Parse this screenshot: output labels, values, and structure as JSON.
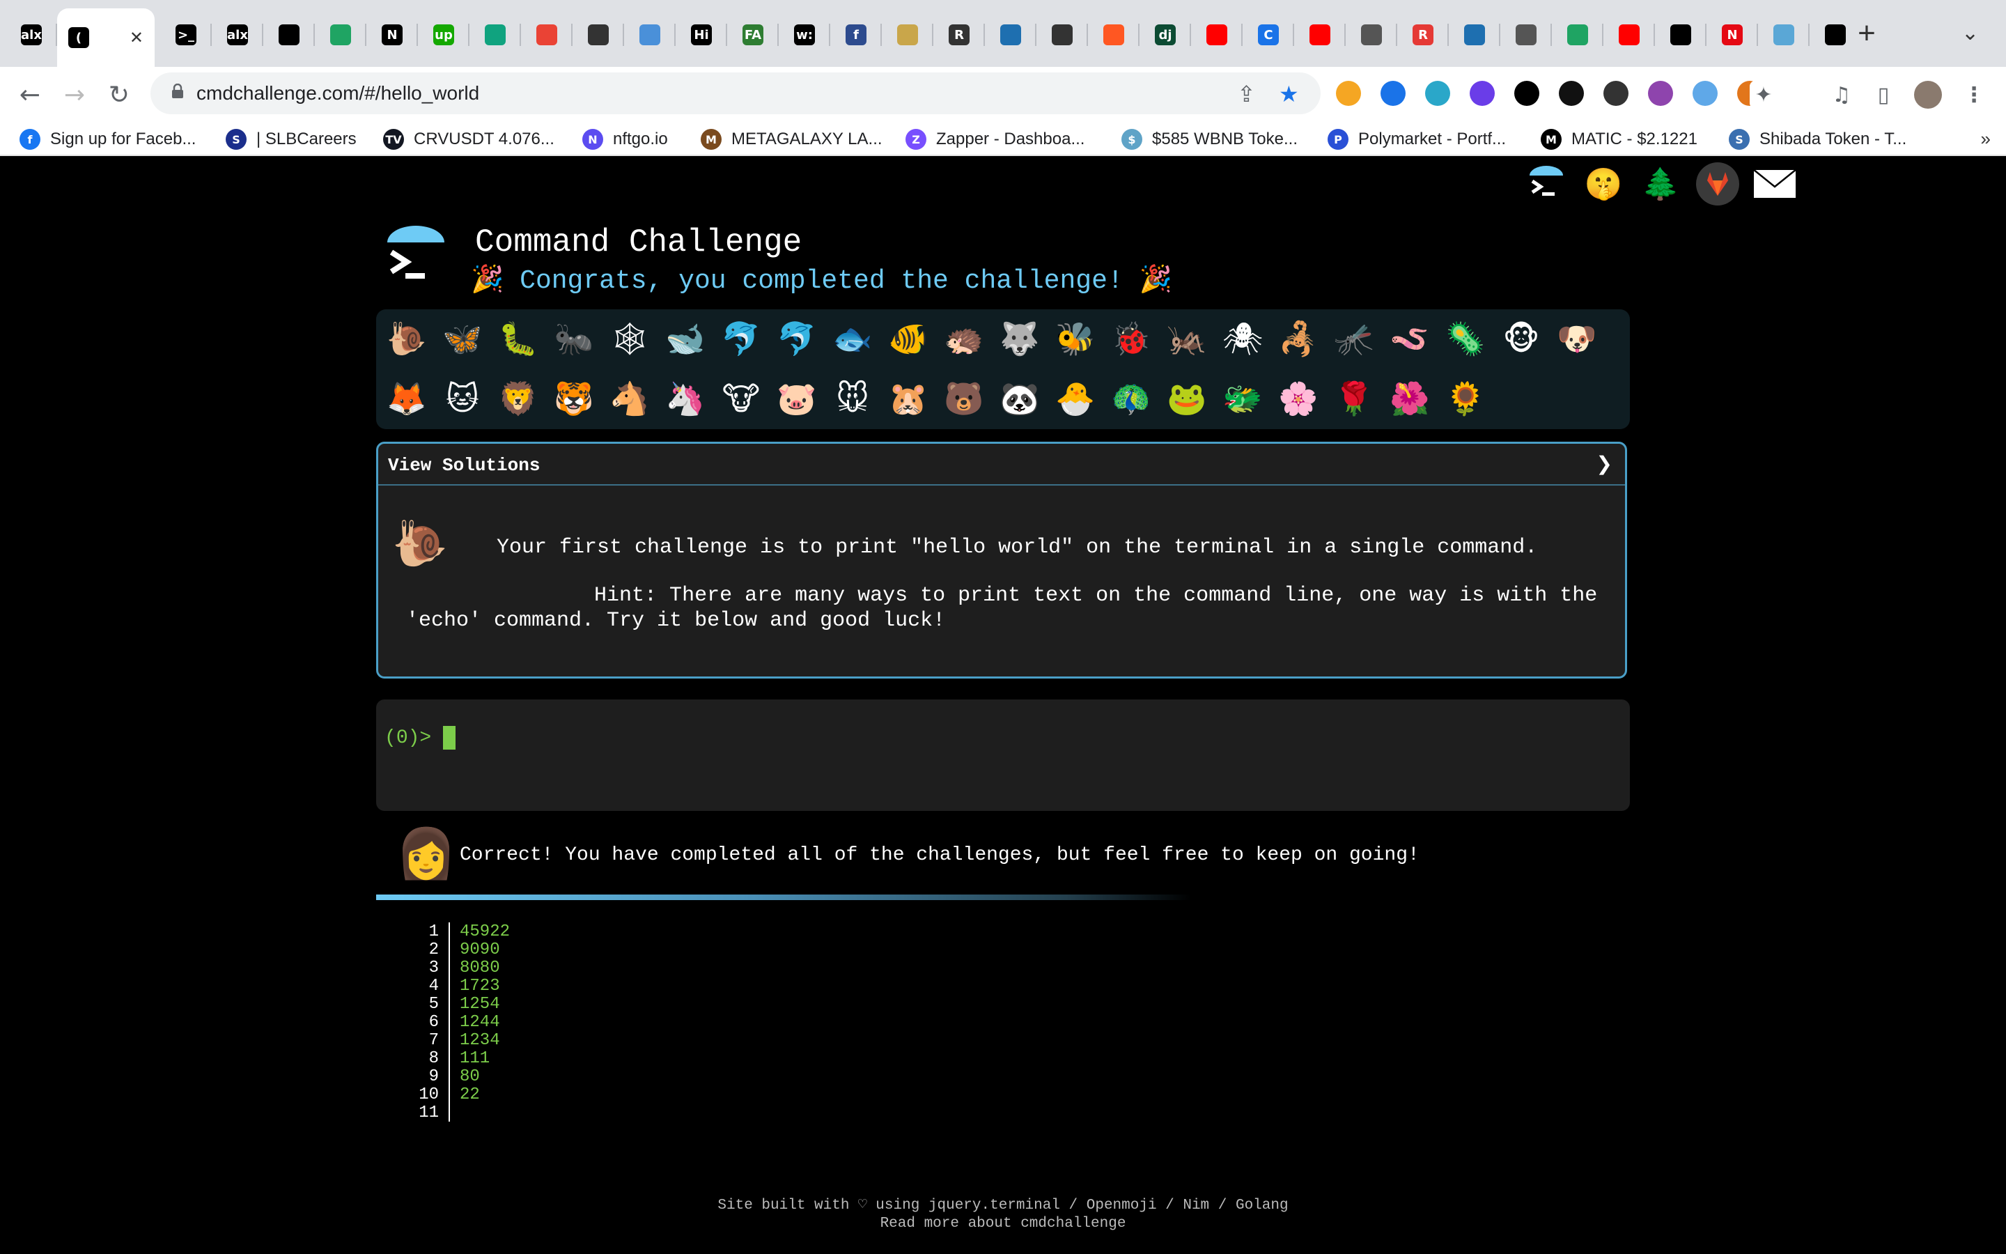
{
  "browser": {
    "tabs": [
      {
        "label": "alx",
        "icon": "alx-icon",
        "color": "#000000"
      },
      {
        "label": "(",
        "icon": "loading-icon",
        "color": "#000000",
        "active": true
      },
      {
        "label": ">_",
        "icon": "terminal-icon",
        "color": "#000000"
      },
      {
        "label": "alx",
        "icon": "alx-icon",
        "color": "#000000"
      },
      {
        "label": "",
        "icon": "github-icon",
        "color": "#000000"
      },
      {
        "label": "",
        "icon": "google-drive-icon",
        "color": "#1fa463"
      },
      {
        "label": "N",
        "icon": "notion-icon",
        "color": "#000000"
      },
      {
        "label": "up",
        "icon": "upwork-icon",
        "color": "#14a800"
      },
      {
        "label": "",
        "icon": "chatgpt-icon",
        "color": "#10a37f"
      },
      {
        "label": "",
        "icon": "maps-pin-icon",
        "color": "#ea4335"
      },
      {
        "label": "",
        "icon": "pen-icon",
        "color": "#333333"
      },
      {
        "label": "",
        "icon": "globe-icon",
        "color": "#4a90d9"
      },
      {
        "label": "Hi",
        "icon": "hi-icon",
        "color": "#000000"
      },
      {
        "label": "FA",
        "icon": "fa-icon",
        "color": "#2e7d32"
      },
      {
        "label": "w:",
        "icon": "w-icon",
        "color": "#000000"
      },
      {
        "label": "f",
        "icon": "f-icon",
        "color": "#2d4b8e"
      },
      {
        "label": "",
        "icon": "doge-icon",
        "color": "#c9a64a"
      },
      {
        "label": "R",
        "icon": "r-icon",
        "color": "#333333"
      },
      {
        "label": "",
        "icon": "video-icon",
        "color": "#1e6fb0"
      },
      {
        "label": "",
        "icon": "pen-icon",
        "color": "#333333"
      },
      {
        "label": "",
        "icon": "chart-icon",
        "color": "#ff5722"
      },
      {
        "label": "dj",
        "icon": "django-icon",
        "color": "#0c4b33"
      },
      {
        "label": "",
        "icon": "youtube-icon",
        "color": "#ff0000"
      },
      {
        "label": "C",
        "icon": "c-icon",
        "color": "#1a73e8"
      },
      {
        "label": "",
        "icon": "youtube-icon",
        "color": "#ff0000"
      },
      {
        "label": "",
        "icon": "globe-icon",
        "color": "#555555"
      },
      {
        "label": "R",
        "icon": "r-icon",
        "color": "#e53935"
      },
      {
        "label": "",
        "icon": "video-icon",
        "color": "#1e6fb0"
      },
      {
        "label": "",
        "icon": "window-icon",
        "color": "#555555"
      },
      {
        "label": "",
        "icon": "google-drive-icon",
        "color": "#1fa463"
      },
      {
        "label": "",
        "icon": "youtube-icon",
        "color": "#ff0000"
      },
      {
        "label": "",
        "icon": "github-icon",
        "color": "#000000"
      },
      {
        "label": "N",
        "icon": "netflix-icon",
        "color": "#e50914"
      },
      {
        "label": "",
        "icon": "flag-icon",
        "color": "#5aa7d6"
      },
      {
        "label": "",
        "icon": "github-icon",
        "color": "#000000"
      }
    ],
    "url": "cmdchallenge.com/#/hello_world",
    "bookmarks": [
      {
        "label": "Sign up for Faceb...",
        "color": "#1877f2",
        "icon": "f"
      },
      {
        "label": "| SLBCareers",
        "color": "#1b2e8c",
        "icon": "S"
      },
      {
        "label": "CRVUSDT 4.076...",
        "color": "#131722",
        "icon": "TV"
      },
      {
        "label": "nftgo.io",
        "color": "#5b4cf0",
        "icon": "N"
      },
      {
        "label": "METAGALAXY LA...",
        "color": "#7a4a1e",
        "icon": "M"
      },
      {
        "label": "Zapper - Dashboa...",
        "color": "#784ffe",
        "icon": "Z"
      },
      {
        "label": "$585 WBNB Toke...",
        "color": "#5fa3c7",
        "icon": "$"
      },
      {
        "label": "Polymarket - Portf...",
        "color": "#2a50d6",
        "icon": "P"
      },
      {
        "label": "MATIC - $2.1221",
        "color": "#000000",
        "icon": "M"
      },
      {
        "label": "Shibada Token - T...",
        "color": "#3a6fb0",
        "icon": "S"
      }
    ]
  },
  "site": {
    "title": "Command Challenge",
    "congrats": "Congrats, you completed the challenge!",
    "party": "🎉",
    "badges_row1": [
      "🐌",
      "🦋",
      "🐛",
      "🐜",
      "🕸",
      "🐋",
      "🐬",
      "🐬",
      "🐟",
      "🐠",
      "🦔",
      "🐺",
      "🐝",
      "🐞",
      "🦗",
      "🕷",
      "🦂",
      "🦟",
      "🪱",
      "🦠",
      "🐵",
      "🐶"
    ],
    "badges_row2": [
      "🦊",
      "🐱",
      "🦁",
      "🐯",
      "🐴",
      "🦄",
      "🐮",
      "🐷",
      "🐭",
      "🐹",
      "🐻",
      "🐼",
      "🐣",
      "🦚",
      "🐸",
      "🐲",
      "🌸",
      "🌹",
      "🌺",
      "🌻"
    ],
    "solutions_label": "View Solutions",
    "chevron": "❯",
    "challenge_icon": "🐌",
    "challenge": "Your first challenge is to print \"hello world\" on the terminal in a single command.",
    "hint_line1": "               Hint: There are many ways to print text on the command line, one way is with the",
    "hint_line2": "'echo' command. Try it below and good luck!",
    "prompt_open": "(",
    "prompt_num": "0",
    "prompt_close": ")>",
    "result_avatar": "👩",
    "result": "Correct! You have completed all of the challenges, but feel free to keep on going!",
    "history": [
      {
        "n": "1",
        "v": "45922"
      },
      {
        "n": "2",
        "v": "9090"
      },
      {
        "n": "3",
        "v": "8080"
      },
      {
        "n": "4",
        "v": "1723"
      },
      {
        "n": "5",
        "v": "1254"
      },
      {
        "n": "6",
        "v": "1244"
      },
      {
        "n": "7",
        "v": "1234"
      },
      {
        "n": "8",
        "v": "111"
      },
      {
        "n": "9",
        "v": "80"
      },
      {
        "n": "10",
        "v": "22"
      },
      {
        "n": "11",
        "v": ""
      }
    ],
    "footer1": "Site built with ♡ using jquery.terminal / Openmoji / Nim / Golang",
    "footer2": "Read more about cmdchallenge"
  }
}
